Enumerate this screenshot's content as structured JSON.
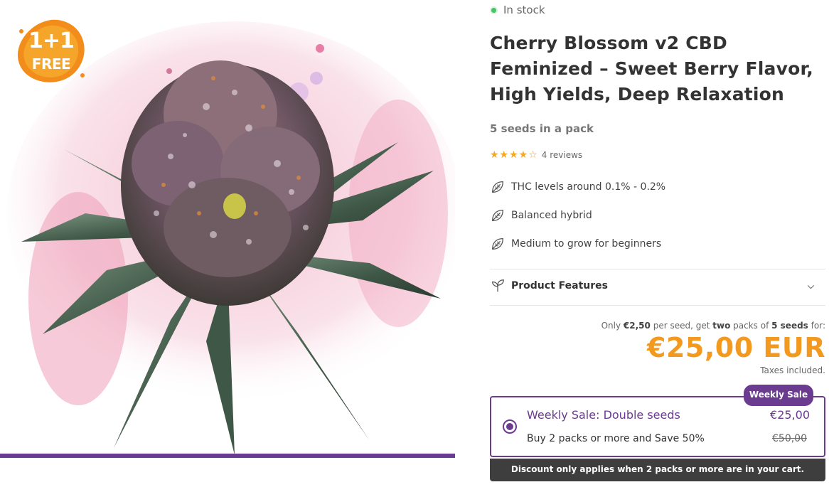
{
  "product_image": {
    "badge": {
      "line1": "1+1",
      "line2": "FREE"
    }
  },
  "stock": {
    "label": "In stock",
    "color": "#45c463"
  },
  "product": {
    "title": "Cherry Blossom v2 CBD Feminized – Sweet Berry Flavor, High Yields, Deep Relaxation",
    "pack_info": "5 seeds in a pack"
  },
  "rating": {
    "stars": "★★★★☆",
    "value": 4,
    "max": 5,
    "reviews": "4 reviews"
  },
  "features": [
    {
      "icon": "leaf-icon",
      "label": "THC levels around 0.1% - 0.2%"
    },
    {
      "icon": "leaf-icon",
      "label": "Balanced hybrid"
    },
    {
      "icon": "leaf-icon",
      "label": "Medium to grow for beginners"
    }
  ],
  "accordion": {
    "label": "Product Features",
    "icon": "sprout-icon",
    "toggle_icon": "chevron-down-icon"
  },
  "pricing": {
    "per_seed_prefix": "Only",
    "per_seed_price": "€2,50",
    "per_seed_mid": "per seed, get",
    "packs_count": "two",
    "packs_of": "packs of",
    "seeds": "5 seeds",
    "per_seed_suffix": "for:",
    "price": "€25,00 EUR",
    "tax_note": "Taxes included.",
    "accent": "#f39a1e"
  },
  "offer": {
    "tag": "Weekly Sale",
    "name": "Weekly Sale: Double seeds",
    "price": "€25,00",
    "description": "Buy 2 packs or more and Save 50%",
    "old_price": "€50,00",
    "note": "Discount only applies when 2 packs or more are in your cart.",
    "accent": "#6a3b8f"
  }
}
